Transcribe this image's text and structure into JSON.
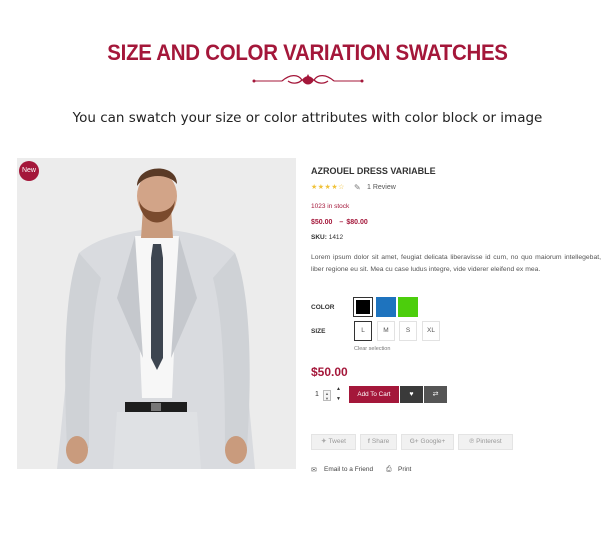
{
  "section": {
    "title": "SIZE AND COLOR VARIATION SWATCHES",
    "subtitle": "You can swatch your size or color attributes with color block or image"
  },
  "product": {
    "badge": "New",
    "name": "AZROUEL DRESS VARIABLE",
    "rating": {
      "stars": "★★★★☆",
      "value": 4,
      "out_of": 5
    },
    "review_text": "1 Review",
    "stock": "1023 in stock",
    "price_min": "$50.00",
    "price_sep": "–",
    "price_max": "$80.00",
    "sku_label": "SKU:",
    "sku": "1412",
    "description": "Lorem ipsum dolor sit amet, feugiat delicata liberavisse id cum, no quo maiorum intellegebat, liber regione eu sit. Mea cu case ludus integre, vide viderer eleifend ex mea.",
    "color_label": "COLOR",
    "colors": [
      {
        "name": "black",
        "hex": "#000000",
        "selected": true
      },
      {
        "name": "blue",
        "hex": "#1e73be",
        "selected": false
      },
      {
        "name": "green",
        "hex": "#4cce0c",
        "selected": false
      }
    ],
    "size_label": "SIZE",
    "sizes": [
      "L",
      "M",
      "S",
      "XL"
    ],
    "selected_size": "L",
    "clear_selection": "Clear selection",
    "price": "$50.00",
    "quantity": "1",
    "add_to_cart": "Add To Cart"
  },
  "share": {
    "tweet": "Tweet",
    "share": "Share",
    "google": "Google+",
    "pinterest": "Pinterest"
  },
  "links": {
    "email": "Email to a Friend",
    "print": "Print"
  },
  "colors": {
    "accent": "#a4173a",
    "dark_button": "#3a3a3a"
  }
}
